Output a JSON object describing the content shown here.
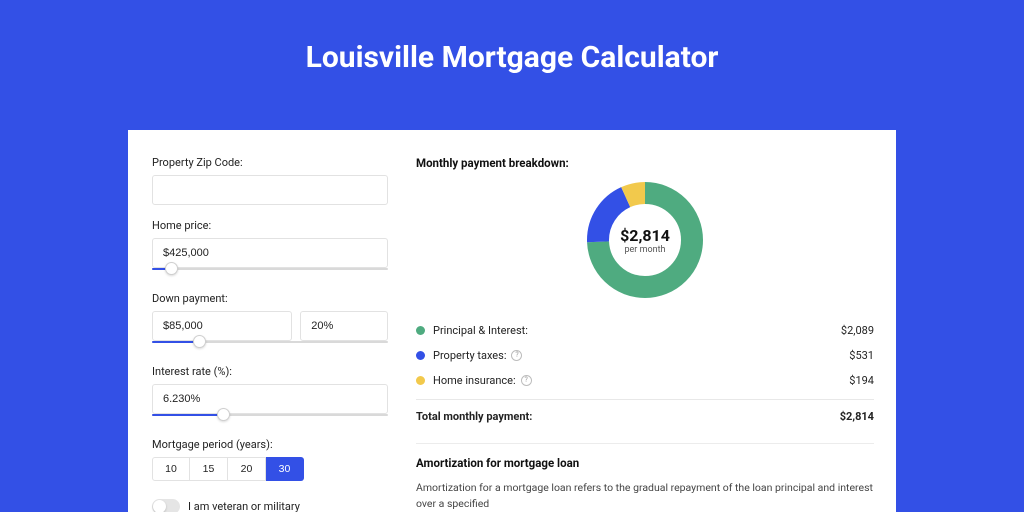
{
  "page_title": "Louisville Mortgage Calculator",
  "form": {
    "zip_label": "Property Zip Code:",
    "zip_value": "",
    "home_price_label": "Home price:",
    "home_price_value": "$425,000",
    "home_price_slider_pct": 8,
    "down_payment_label": "Down payment:",
    "down_payment_value": "$85,000",
    "down_payment_pct_value": "20%",
    "down_payment_slider_pct": 20,
    "interest_label": "Interest rate (%):",
    "interest_value": "6.230%",
    "interest_slider_pct": 30,
    "period_label": "Mortgage period (years):",
    "period_options": [
      "10",
      "15",
      "20",
      "30"
    ],
    "period_selected": "30",
    "veteran_label": "I am veteran or military"
  },
  "breakdown": {
    "title": "Monthly payment breakdown:",
    "total_value": "$2,814",
    "total_sub": "per month",
    "items": [
      {
        "label": "Principal & Interest:",
        "value": "$2,089",
        "color": "#4fab80",
        "has_info": false
      },
      {
        "label": "Property taxes:",
        "value": "$531",
        "color": "#3350e6",
        "has_info": true
      },
      {
        "label": "Home insurance:",
        "value": "$194",
        "color": "#f2c94c",
        "has_info": true
      }
    ],
    "total_label": "Total monthly payment:",
    "total_row_value": "$2,814"
  },
  "chart_data": {
    "type": "pie",
    "title": "Monthly payment breakdown",
    "series": [
      {
        "name": "Principal & Interest",
        "value": 2089,
        "color": "#4fab80"
      },
      {
        "name": "Property taxes",
        "value": 531,
        "color": "#3350e6"
      },
      {
        "name": "Home insurance",
        "value": 194,
        "color": "#f2c94c"
      }
    ],
    "total": 2814,
    "center_label": "$2,814",
    "center_sub": "per month"
  },
  "amortization": {
    "title": "Amortization for mortgage loan",
    "body": "Amortization for a mortgage loan refers to the gradual repayment of the loan principal and interest over a specified"
  }
}
